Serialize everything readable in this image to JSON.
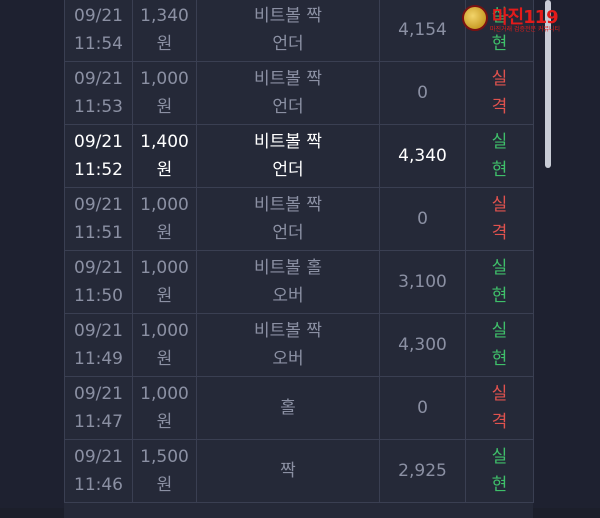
{
  "logo": {
    "brand": "마진119",
    "tagline": "마진거래 검증전문 커뮤니티"
  },
  "colors": {
    "win": "#3fbf6a",
    "lose": "#e0524e",
    "background": "#252938"
  },
  "rows": [
    {
      "date": "09/21",
      "time": "11:54",
      "amount": "1,340",
      "unit": "원",
      "pick1": "비트볼 짝",
      "pick2": "언더",
      "payout": "4,154",
      "res1": "실",
      "res2": "현",
      "status": "win"
    },
    {
      "date": "09/21",
      "time": "11:53",
      "amount": "1,000",
      "unit": "원",
      "pick1": "비트볼 짝",
      "pick2": "언더",
      "payout": "0",
      "res1": "실",
      "res2": "격",
      "status": "lose"
    },
    {
      "date": "09/21",
      "time": "11:52",
      "amount": "1,400",
      "unit": "원",
      "pick1": "비트볼 짝",
      "pick2": "언더",
      "payout": "4,340",
      "res1": "실",
      "res2": "현",
      "status": "win"
    },
    {
      "date": "09/21",
      "time": "11:51",
      "amount": "1,000",
      "unit": "원",
      "pick1": "비트볼 짝",
      "pick2": "언더",
      "payout": "0",
      "res1": "실",
      "res2": "격",
      "status": "lose"
    },
    {
      "date": "09/21",
      "time": "11:50",
      "amount": "1,000",
      "unit": "원",
      "pick1": "비트볼 홀",
      "pick2": "오버",
      "payout": "3,100",
      "res1": "실",
      "res2": "현",
      "status": "win"
    },
    {
      "date": "09/21",
      "time": "11:49",
      "amount": "1,000",
      "unit": "원",
      "pick1": "비트볼 짝",
      "pick2": "오버",
      "payout": "4,300",
      "res1": "실",
      "res2": "현",
      "status": "win"
    },
    {
      "date": "09/21",
      "time": "11:47",
      "amount": "1,000",
      "unit": "원",
      "pick1": "홀",
      "pick2": "",
      "payout": "0",
      "res1": "실",
      "res2": "격",
      "status": "lose"
    },
    {
      "date": "09/21",
      "time": "11:46",
      "amount": "1,500",
      "unit": "원",
      "pick1": "짝",
      "pick2": "",
      "payout": "2,925",
      "res1": "실",
      "res2": "현",
      "status": "win"
    }
  ]
}
